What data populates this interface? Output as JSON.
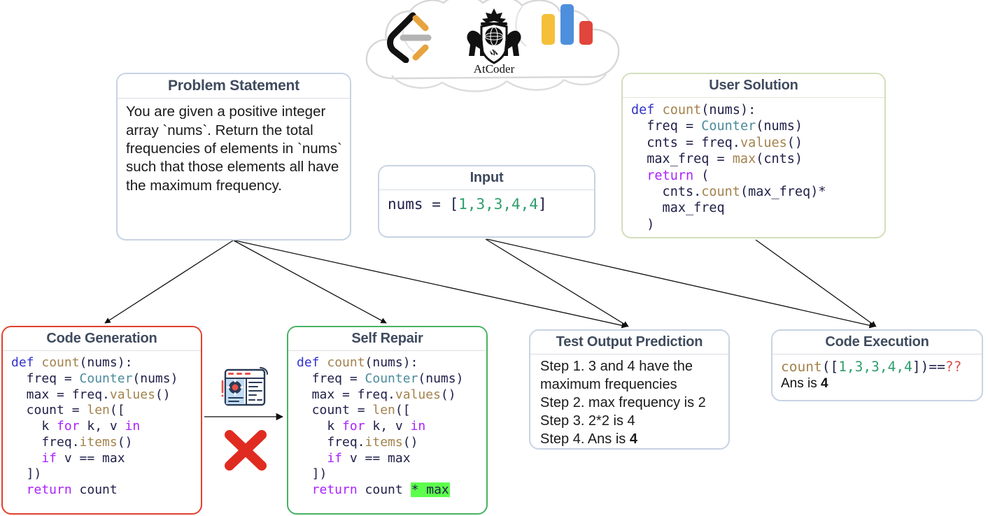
{
  "cloud": {
    "name": "online-judges-cloud",
    "logos": [
      {
        "name": "leetcode-logo",
        "label": "LeetCode"
      },
      {
        "name": "atcoder-logo",
        "label": "AtCoder"
      },
      {
        "name": "codeforces-logo",
        "label": "CodeForces"
      }
    ],
    "atcoder_wordmark": "AtCoder"
  },
  "problem_statement": {
    "title": "Problem Statement",
    "text": "You are given a positive integer array `nums`. Return the total frequencies of elements in `nums` such that those elements all have the maximum frequency."
  },
  "input": {
    "title": "Input",
    "var_name": "nums",
    "equals": " = ",
    "open_bracket": "[",
    "values": "1,3,3,4,4",
    "close_bracket": "]"
  },
  "user_solution": {
    "title": "User Solution",
    "code_lines": [
      "def count(nums):",
      "  freq = Counter(nums)",
      "  cnts = freq.values()",
      "  max_freq = max(cnts)",
      "  return (",
      "    cnts.count(max_freq)*",
      "    max_freq",
      "  )"
    ],
    "tokens": {
      "def": "def",
      "fn_count": "count",
      "args_nums": "(nums):",
      "freq_assign": "  freq = ",
      "counter": "Counter",
      "counter_args": "(nums)",
      "cnts_assign": "  cnts = freq.",
      "values": "values",
      "values_args": "()",
      "maxfreq_assign": "  max_freq = ",
      "max": "max",
      "max_args": "(cnts)",
      "return": "  return",
      "return_paren": " (",
      "cnts_dot": "    cnts.",
      "count_call": "count",
      "count_args": "(max_freq)*",
      "max_freq": "    max_freq",
      "close_paren": "  )"
    }
  },
  "code_generation": {
    "title": "Code Generation",
    "border_color": "#e0402c",
    "code_lines": [
      "def count(nums):",
      "  freq = Counter(nums)",
      "  max = freq.values()",
      "  count = len([",
      "    k for k, v in",
      "    freq.items()",
      "    if v == max",
      "  ])",
      "  return count"
    ],
    "tokens": {
      "def": "def",
      "fn_count": " count",
      "args": "(nums):",
      "freq_assign": "  freq = ",
      "counter": "Counter",
      "counter_args": "(nums)",
      "max_assign": "  max = freq.",
      "values": "values",
      "values_args": "()",
      "count_assign": "  count = ",
      "len": "len",
      "len_open": "([",
      "k": "    k ",
      "for": "for",
      "kv": " k, v ",
      "in": "in",
      "freq_items": "    freq.",
      "items": "items",
      "items_args": "()",
      "if": "    if",
      "cond": " v == max",
      "close": "  ])",
      "return": "  return",
      "return_val": " count"
    }
  },
  "self_repair": {
    "title": "Self Repair",
    "border_color": "#48b263",
    "highlight_color": "#5cff4c",
    "code_lines": [
      "def count(nums):",
      "  freq = Counter(nums)",
      "  max = freq.values()",
      "  count = len([",
      "    k for k, v in",
      "    freq.items()",
      "    if v == max",
      "  ])",
      "  return count * max"
    ],
    "tokens": {
      "def": "def",
      "fn_count": " count",
      "args": "(nums):",
      "freq_assign": "  freq = ",
      "counter": "Counter",
      "counter_args": "(nums)",
      "max_assign": "  max = freq.",
      "values": "values",
      "values_args": "()",
      "count_assign": "  count = ",
      "len": "len",
      "len_open": "([",
      "k": "    k ",
      "for": "for",
      "kv": " k, v ",
      "in": "in",
      "freq_items": "    freq.",
      "items": "items",
      "items_args": "()",
      "if": "    if",
      "cond": " v == max",
      "close": "  ])",
      "return": "  return",
      "return_val": " count ",
      "patch": "* max"
    }
  },
  "test_output_prediction": {
    "title": "Test Output Prediction",
    "steps": [
      "Step 1. 3 and 4  have the maximum frequencies",
      "Step 2. max frequency is 2",
      "Step 3. 2*2 is 4",
      "Step 4. Ans is 4"
    ],
    "step4_prefix": "Step 4. Ans is ",
    "step4_answer": "4"
  },
  "code_execution": {
    "title": "Code Execution",
    "call_fn": "count",
    "call_open": "([",
    "call_values": "1,3,3,4,4",
    "call_close": "])",
    "equals": "==",
    "unknown": "??",
    "ans_prefix": "Ans is ",
    "ans_value": "4"
  },
  "repair_icon": {
    "name": "code-settings-window-icon"
  },
  "fail_marker": {
    "name": "red-cross-icon",
    "color": "#e02b20"
  }
}
